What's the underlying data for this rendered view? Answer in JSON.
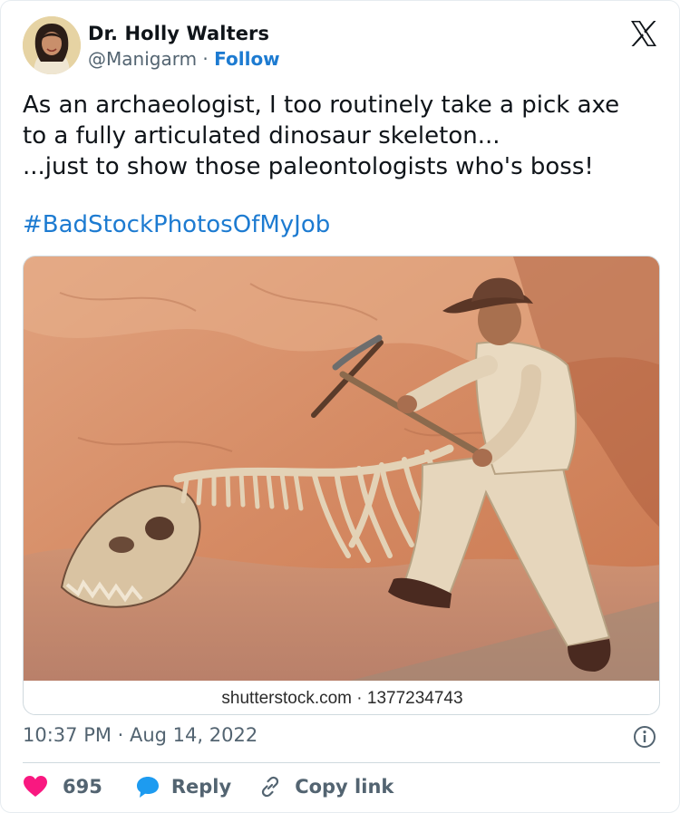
{
  "author": {
    "name": "Dr. Holly Walters",
    "handle": "@Manigarm",
    "separator": "·",
    "follow_label": "Follow"
  },
  "tweet": {
    "text": "As an archaeologist, I too routinely take a pick axe\nto a fully articulated dinosaur skeleton...\n...just to show those paleontologists who's boss!",
    "hashtag": "#BadStockPhotosOfMyJob"
  },
  "media": {
    "caption": "shutterstock.com · 1377234743"
  },
  "meta": {
    "timestamp": "10:37 PM · Aug 14, 2022"
  },
  "actions": {
    "likes": "695",
    "reply_label": "Reply",
    "copy_link_label": "Copy link"
  },
  "colors": {
    "link_blue": "#1d7bd1",
    "like_red": "#f91880",
    "reply_blue": "#1d9bf0",
    "secondary_text": "#536471"
  },
  "icons": {
    "logo": "x-logo-icon",
    "info": "info-icon",
    "like": "heart-icon",
    "reply": "speech-bubble-icon",
    "copy_link": "link-icon"
  }
}
